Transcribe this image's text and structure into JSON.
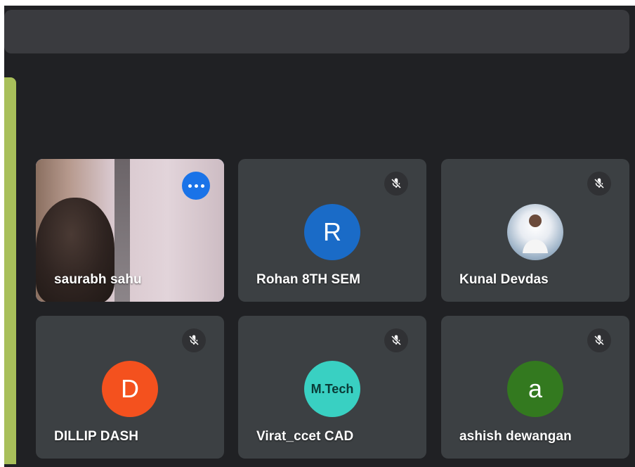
{
  "colors": {
    "background": "#202124",
    "tile": "#3c4043",
    "active_border": "#8ab4f8",
    "more_button": "#1a73e8",
    "side_bar": "#a8bf5a"
  },
  "participants": [
    {
      "name": "saurabh sahu",
      "avatar_type": "video",
      "has_more_menu": true,
      "muted": false
    },
    {
      "name": "Rohan 8TH SEM",
      "avatar_type": "letter",
      "initial": "R",
      "avatar_color": "#1a6bc7",
      "muted": true
    },
    {
      "name": "Kunal Devdas",
      "avatar_type": "photo",
      "muted": true
    },
    {
      "name": "DILLIP DASH",
      "avatar_type": "letter",
      "initial": "D",
      "avatar_color": "#f4511e",
      "muted": true
    },
    {
      "name": "Virat_ccet CAD",
      "avatar_type": "image-text",
      "avatar_text": "M.Tech",
      "muted": true
    },
    {
      "name": "ashish dewangan",
      "avatar_type": "letter",
      "initial": "a",
      "avatar_color": "#33791f",
      "muted": true
    }
  ],
  "icons": {
    "mute": "mic-off-icon",
    "more": "more-options-icon"
  }
}
